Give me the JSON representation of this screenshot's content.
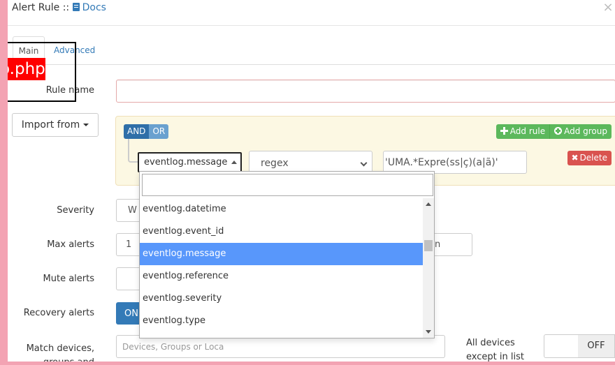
{
  "header": {
    "title": "Alert Rule ::",
    "docs_label": "Docs",
    "close_glyph": "×"
  },
  "tabs": [
    {
      "label": "Main",
      "active": true
    },
    {
      "label": "Advanced",
      "active": false
    }
  ],
  "debug_overlay": {
    "text": "o.php"
  },
  "form": {
    "rule_name": {
      "label": "Rule name",
      "value": ""
    },
    "import_button": "Import from",
    "query_builder": {
      "and_label": "AND",
      "or_label": "OR",
      "add_rule_label": "Add rule",
      "add_group_label": "Add group",
      "rule": {
        "field": "eventlog.message",
        "operator": "regex",
        "value": "'UMA.*Expre(ss|ç)(a|ã)'",
        "delete_label": "Delete"
      }
    },
    "severity": {
      "label": "Severity",
      "value": "W"
    },
    "max_alerts": {
      "label": "Max alerts",
      "value": "1",
      "interval_suffix": "n"
    },
    "mute_alerts": {
      "label": "Mute alerts"
    },
    "recovery_alerts": {
      "label": "Recovery alerts",
      "toggle_text": "ON"
    },
    "match_devices": {
      "label_line1": "Match devices,",
      "label_line2": "groups and",
      "placeholder": "Devices, Groups or Loca",
      "all_devices_line1": "All devices",
      "all_devices_line2": "except in list",
      "toggle_text": "OFF"
    }
  },
  "field_dropdown": {
    "search_value": "",
    "items": [
      "eventlog.datetime",
      "eventlog.event_id",
      "eventlog.message",
      "eventlog.reference",
      "eventlog.severity",
      "eventlog.type"
    ],
    "selected": "eventlog.message"
  },
  "colors": {
    "page_border": "#f3a3b3",
    "primary": "#337ab7",
    "success": "#5cb85c",
    "danger": "#d9534f",
    "dropdown_highlight": "#5897fb",
    "query_bg": "#fcf8e3"
  }
}
